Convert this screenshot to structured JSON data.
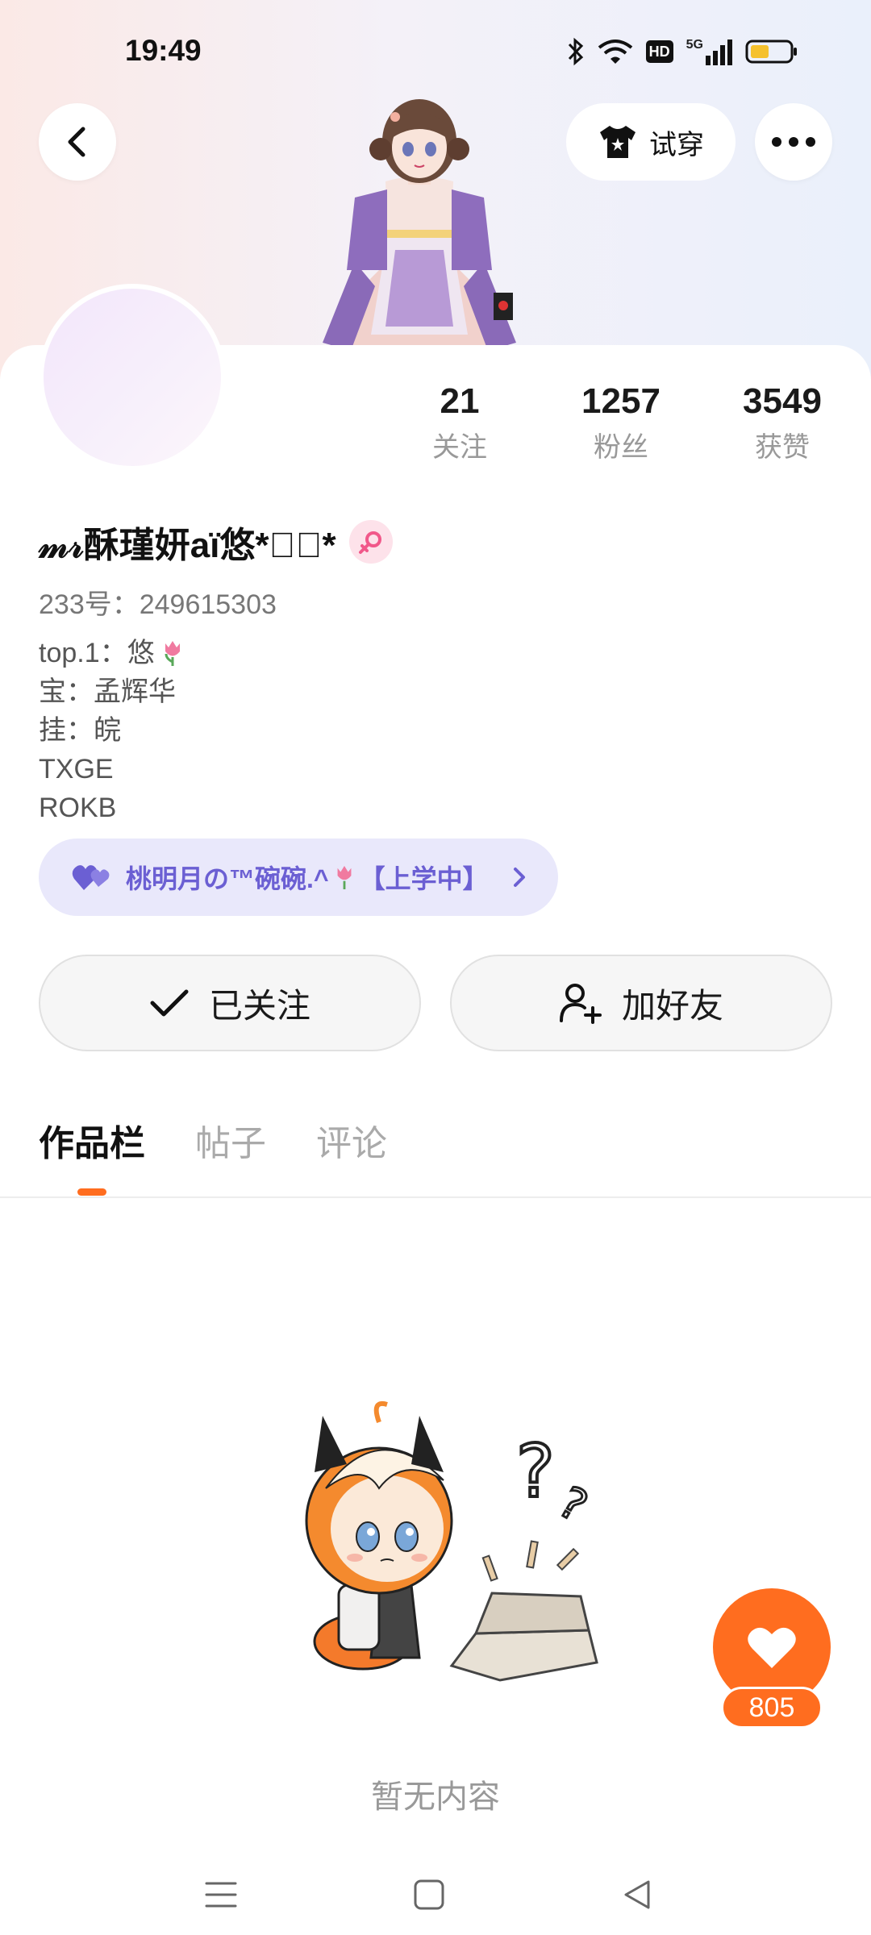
{
  "status": {
    "time": "19:49",
    "icons": [
      "bluetooth-icon",
      "wifi-icon",
      "hd-icon",
      "5g-signal-icon",
      "battery-icon"
    ],
    "hd_label": "HD",
    "network_label": "5G"
  },
  "header": {
    "try_on_label": "试穿",
    "icons": [
      "back-icon",
      "tshirt-icon",
      "more-icon"
    ]
  },
  "stats": [
    {
      "value": "21",
      "label": "关注"
    },
    {
      "value": "1257",
      "label": "粉丝"
    },
    {
      "value": "3549",
      "label": "获赞"
    }
  ],
  "profile": {
    "username": "𝓂𝓇酥瑾妍aï悠*✲゚*",
    "gender_icon": "female-icon",
    "uid": "233号：249615303",
    "bio": {
      "line1": "top.1：悠",
      "line2": "宝：孟辉华",
      "line3": "挂：皖",
      "line4": "TXGE",
      "line5": "ROKB"
    }
  },
  "cp": {
    "text": "桃明月の™碗碗.^",
    "suffix": "【上学中】"
  },
  "actions": {
    "follow_label": "已关注",
    "add_friend_label": "加好友"
  },
  "tabs": [
    "作品栏",
    "帖子",
    "评论"
  ],
  "empty_state": "暂无内容",
  "like": {
    "count": "805"
  },
  "colors": {
    "accent": "#ff6d1f",
    "cp_bg": "#e9e8fb",
    "cp_text": "#6b5fd3",
    "gender_bg": "#fde2ea"
  }
}
